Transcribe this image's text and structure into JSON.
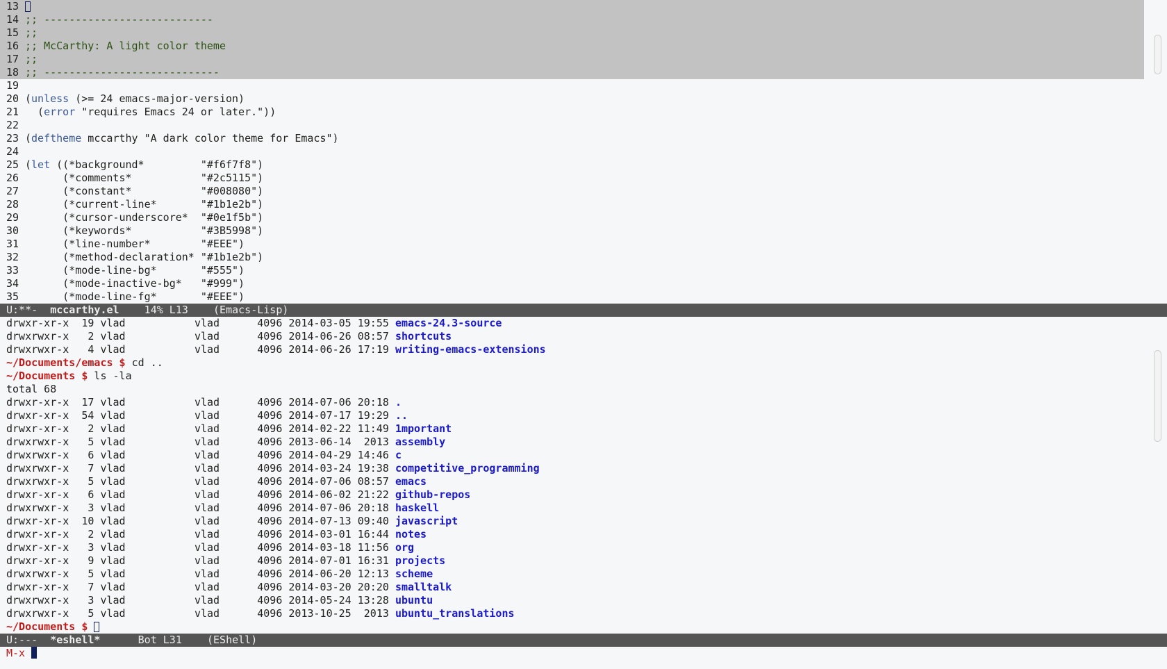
{
  "editor": {
    "lines": [
      {
        "n": "13",
        "t": "",
        "cls": ""
      },
      {
        "n": "14",
        "t": ";; ---------------------------",
        "cls": "com"
      },
      {
        "n": "15",
        "t": ";;",
        "cls": "com"
      },
      {
        "n": "16",
        "t": ";; McCarthy: A light color theme",
        "cls": "com"
      },
      {
        "n": "17",
        "t": ";;",
        "cls": "com"
      },
      {
        "n": "18",
        "t": ";; ----------------------------",
        "cls": "com"
      },
      {
        "n": "19",
        "t": "",
        "cls": ""
      },
      {
        "n": "20",
        "t": "(unless (>= 24 emacs-major-version)",
        "cls": ""
      },
      {
        "n": "21",
        "t": "  (error \"requires Emacs 24 or later.\"))",
        "cls": ""
      },
      {
        "n": "22",
        "t": "",
        "cls": ""
      },
      {
        "n": "23",
        "t": "(deftheme mccarthy \"A dark color theme for Emacs\")",
        "cls": ""
      },
      {
        "n": "24",
        "t": "",
        "cls": ""
      },
      {
        "n": "25",
        "t": "(let ((*background*         \"#f6f7f8\")",
        "cls": ""
      },
      {
        "n": "26",
        "t": "      (*comments*           \"#2c5115\")",
        "cls": ""
      },
      {
        "n": "27",
        "t": "      (*constant*           \"#008080\")",
        "cls": ""
      },
      {
        "n": "28",
        "t": "      (*current-line*       \"#1b1e2b\")",
        "cls": ""
      },
      {
        "n": "29",
        "t": "      (*cursor-underscore*  \"#0e1f5b\")",
        "cls": ""
      },
      {
        "n": "30",
        "t": "      (*keywords*           \"#3B5998\")",
        "cls": ""
      },
      {
        "n": "31",
        "t": "      (*line-number*        \"#EEE\")",
        "cls": ""
      },
      {
        "n": "32",
        "t": "      (*method-declaration* \"#1b1e2b\")",
        "cls": ""
      },
      {
        "n": "33",
        "t": "      (*mode-line-bg*       \"#555\")",
        "cls": ""
      },
      {
        "n": "34",
        "t": "      (*mode-inactive-bg*   \"#999\")",
        "cls": ""
      },
      {
        "n": "35",
        "t": "      (*mode-line-fg*       \"#EEE\")",
        "cls": ""
      }
    ],
    "modeline": {
      "state": "U:**-  ",
      "buffer": "mccarthy.el",
      "position": "    14% L13    ",
      "mode": "(Emacs-Lisp)"
    }
  },
  "shell": {
    "lines": [
      {
        "type": "entry",
        "perm": "drwxr-xr-x",
        "links": "19",
        "owner": "vlad",
        "group": "vlad",
        "size": "4096",
        "date": "2014-03-05 19:55",
        "name": "emacs-24.3-source"
      },
      {
        "type": "entry",
        "perm": "drwxrwxr-x",
        "links": " 2",
        "owner": "vlad",
        "group": "vlad",
        "size": "4096",
        "date": "2014-06-26 08:57",
        "name": "shortcuts"
      },
      {
        "type": "entry",
        "perm": "drwxrwxr-x",
        "links": " 4",
        "owner": "vlad",
        "group": "vlad",
        "size": "4096",
        "date": "2014-06-26 17:19",
        "name": "writing-emacs-extensions"
      },
      {
        "type": "prompt",
        "prompt": "~/Documents/emacs $",
        "cmd": " cd .."
      },
      {
        "type": "prompt",
        "prompt": "~/Documents $",
        "cmd": " ls -la"
      },
      {
        "type": "text",
        "t": "total 68"
      },
      {
        "type": "entry",
        "perm": "drwxr-xr-x",
        "links": "17",
        "owner": "vlad",
        "group": "vlad",
        "size": "4096",
        "date": "2014-07-06 20:18",
        "name": "."
      },
      {
        "type": "entry",
        "perm": "drwxr-xr-x",
        "links": "54",
        "owner": "vlad",
        "group": "vlad",
        "size": "4096",
        "date": "2014-07-17 19:29",
        "name": ".."
      },
      {
        "type": "entry",
        "perm": "drwxr-xr-x",
        "links": " 2",
        "owner": "vlad",
        "group": "vlad",
        "size": "4096",
        "date": "2014-02-22 11:49",
        "name": "1mportant"
      },
      {
        "type": "entry",
        "perm": "drwxrwxr-x",
        "links": " 5",
        "owner": "vlad",
        "group": "vlad",
        "size": "4096",
        "date": "2013-06-14  2013",
        "name": "assembly"
      },
      {
        "type": "entry",
        "perm": "drwxrwxr-x",
        "links": " 6",
        "owner": "vlad",
        "group": "vlad",
        "size": "4096",
        "date": "2014-04-29 14:46",
        "name": "c"
      },
      {
        "type": "entry",
        "perm": "drwxrwxr-x",
        "links": " 7",
        "owner": "vlad",
        "group": "vlad",
        "size": "4096",
        "date": "2014-03-24 19:38",
        "name": "competitive_programming"
      },
      {
        "type": "entry",
        "perm": "drwxrwxr-x",
        "links": " 5",
        "owner": "vlad",
        "group": "vlad",
        "size": "4096",
        "date": "2014-07-06 08:57",
        "name": "emacs"
      },
      {
        "type": "entry",
        "perm": "drwxr-xr-x",
        "links": " 6",
        "owner": "vlad",
        "group": "vlad",
        "size": "4096",
        "date": "2014-06-02 21:22",
        "name": "github-repos"
      },
      {
        "type": "entry",
        "perm": "drwxrwxr-x",
        "links": " 3",
        "owner": "vlad",
        "group": "vlad",
        "size": "4096",
        "date": "2014-07-06 20:18",
        "name": "haskell"
      },
      {
        "type": "entry",
        "perm": "drwxr-xr-x",
        "links": "10",
        "owner": "vlad",
        "group": "vlad",
        "size": "4096",
        "date": "2014-07-13 09:40",
        "name": "javascript"
      },
      {
        "type": "entry",
        "perm": "drwxr-xr-x",
        "links": " 2",
        "owner": "vlad",
        "group": "vlad",
        "size": "4096",
        "date": "2014-03-01 16:44",
        "name": "notes"
      },
      {
        "type": "entry",
        "perm": "drwxr-xr-x",
        "links": " 3",
        "owner": "vlad",
        "group": "vlad",
        "size": "4096",
        "date": "2014-03-18 11:56",
        "name": "org"
      },
      {
        "type": "entry",
        "perm": "drwxr-xr-x",
        "links": " 9",
        "owner": "vlad",
        "group": "vlad",
        "size": "4096",
        "date": "2014-07-01 16:31",
        "name": "projects"
      },
      {
        "type": "entry",
        "perm": "drwxrwxr-x",
        "links": " 5",
        "owner": "vlad",
        "group": "vlad",
        "size": "4096",
        "date": "2014-06-20 12:13",
        "name": "scheme"
      },
      {
        "type": "entry",
        "perm": "drwxr-xr-x",
        "links": " 7",
        "owner": "vlad",
        "group": "vlad",
        "size": "4096",
        "date": "2014-03-20 20:20",
        "name": "smalltalk"
      },
      {
        "type": "entry",
        "perm": "drwxrwxr-x",
        "links": " 3",
        "owner": "vlad",
        "group": "vlad",
        "size": "4096",
        "date": "2014-05-24 13:28",
        "name": "ubuntu"
      },
      {
        "type": "entry",
        "perm": "drwxrwxr-x",
        "links": " 5",
        "owner": "vlad",
        "group": "vlad",
        "size": "4096",
        "date": "2013-10-25  2013",
        "name": "ubuntu_translations"
      },
      {
        "type": "prompt-cursor",
        "prompt": "~/Documents $",
        "cmd": " "
      }
    ],
    "modeline": {
      "state": "U:---  ",
      "buffer": "*eshell*",
      "position": "      Bot L31    ",
      "mode": "(EShell)"
    }
  },
  "minibuffer": {
    "label": "M-x "
  },
  "colors": {
    "background": "#f6f7f8",
    "comments": "#2c5115",
    "keywords": "#3b5998",
    "mode_line_bg": "#555",
    "mode_line_fg": "#eee",
    "cursor": "#0e1f5b",
    "directory": "#1a1acc",
    "prompt": "#c21b1b"
  }
}
